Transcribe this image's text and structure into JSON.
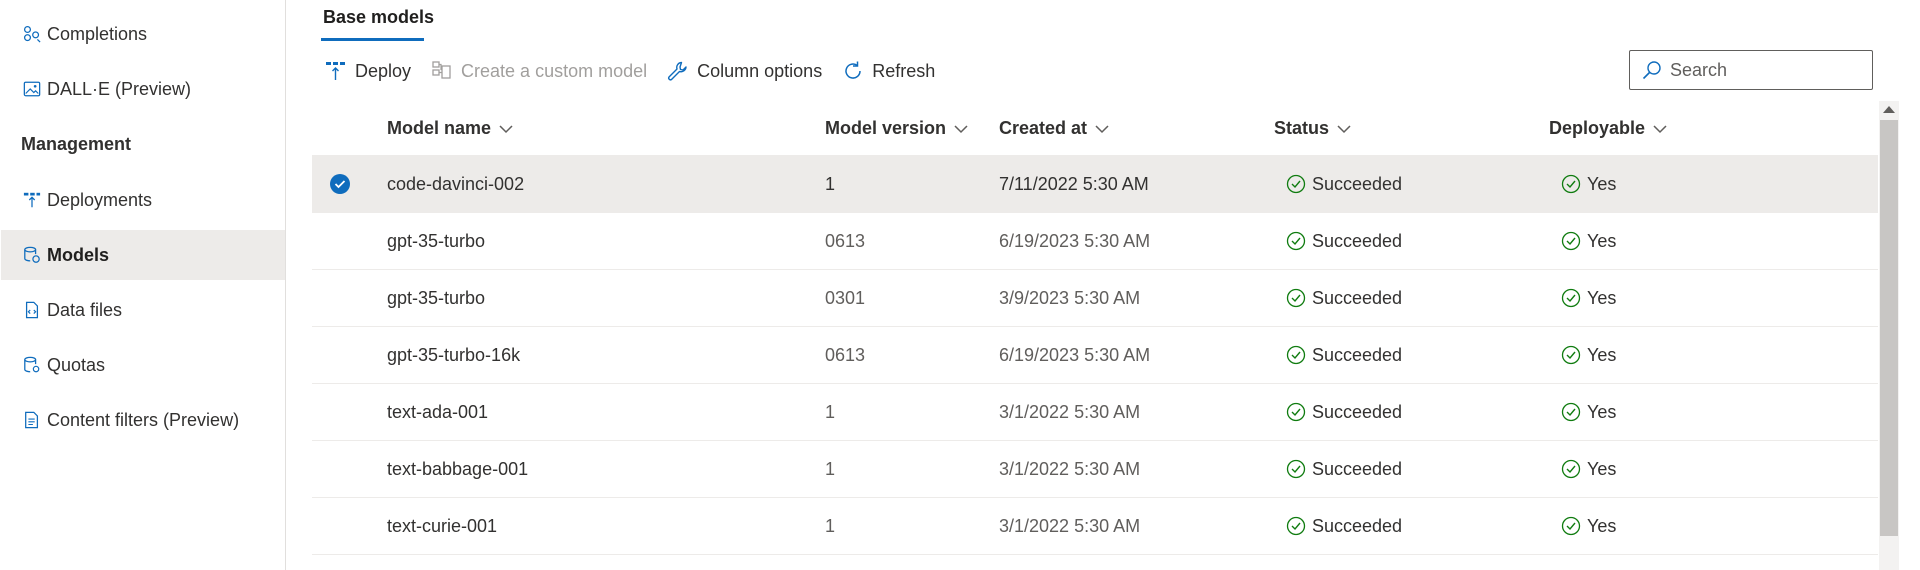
{
  "sidebar": {
    "items": [
      {
        "label": "Completions",
        "icon": "completions-icon",
        "active": false
      },
      {
        "label": "DALL·E (Preview)",
        "icon": "image-icon",
        "active": false
      },
      {
        "label": "Deployments",
        "icon": "deployments-icon",
        "active": false
      },
      {
        "label": "Models",
        "icon": "models-icon",
        "active": true
      },
      {
        "label": "Data files",
        "icon": "data-file-icon",
        "active": false
      },
      {
        "label": "Quotas",
        "icon": "quotas-icon",
        "active": false
      },
      {
        "label": "Content filters (Preview)",
        "icon": "content-filter-icon",
        "active": false
      }
    ],
    "section_management": "Management"
  },
  "tabs": {
    "base_models": "Base models"
  },
  "toolbar": {
    "deploy": "Deploy",
    "create_custom_model": "Create a custom model",
    "column_options": "Column options",
    "refresh": "Refresh"
  },
  "search": {
    "placeholder": "Search"
  },
  "grid": {
    "columns": {
      "model_name": "Model name",
      "model_version": "Model version",
      "created_at": "Created at",
      "status": "Status",
      "deployable": "Deployable"
    },
    "rows": [
      {
        "name": "code-davinci-002",
        "version": "1",
        "created": "7/11/2022 5:30 AM",
        "status": "Succeeded",
        "deployable": "Yes",
        "selected": true
      },
      {
        "name": "gpt-35-turbo",
        "version": "0613",
        "created": "6/19/2023 5:30 AM",
        "status": "Succeeded",
        "deployable": "Yes",
        "selected": false
      },
      {
        "name": "gpt-35-turbo",
        "version": "0301",
        "created": "3/9/2023 5:30 AM",
        "status": "Succeeded",
        "deployable": "Yes",
        "selected": false
      },
      {
        "name": "gpt-35-turbo-16k",
        "version": "0613",
        "created": "6/19/2023 5:30 AM",
        "status": "Succeeded",
        "deployable": "Yes",
        "selected": false
      },
      {
        "name": "text-ada-001",
        "version": "1",
        "created": "3/1/2022 5:30 AM",
        "status": "Succeeded",
        "deployable": "Yes",
        "selected": false
      },
      {
        "name": "text-babbage-001",
        "version": "1",
        "created": "3/1/2022 5:30 AM",
        "status": "Succeeded",
        "deployable": "Yes",
        "selected": false
      },
      {
        "name": "text-curie-001",
        "version": "1",
        "created": "3/1/2022 5:30 AM",
        "status": "Succeeded",
        "deployable": "Yes",
        "selected": false
      }
    ]
  },
  "colors": {
    "accent": "#0f6cbd",
    "success": "#107c10",
    "selected_row": "#edebe9"
  }
}
